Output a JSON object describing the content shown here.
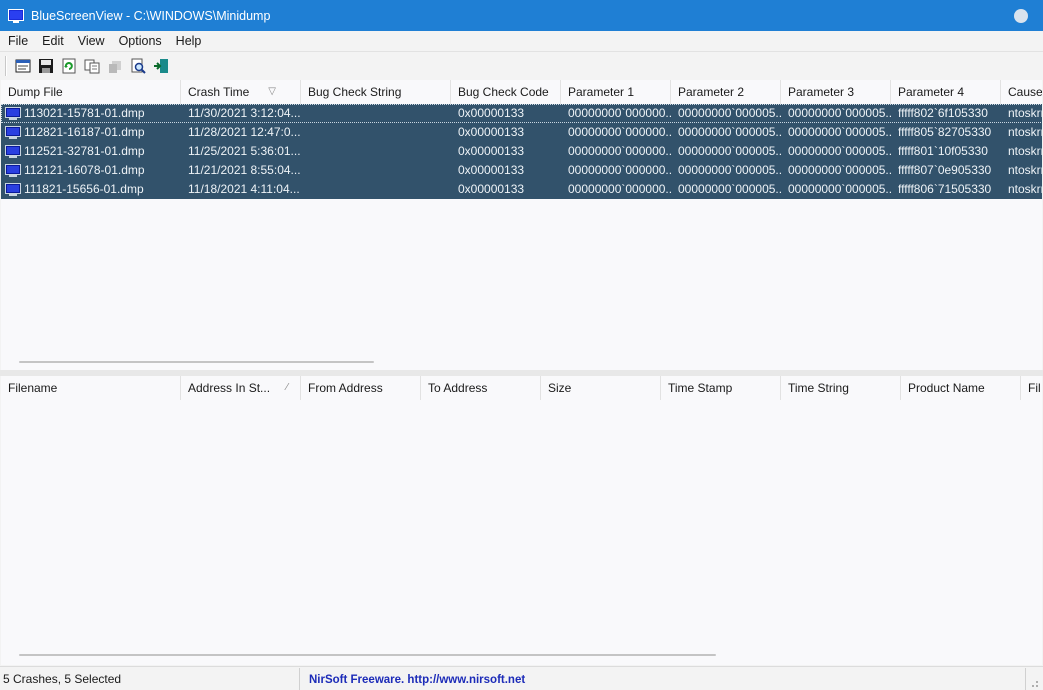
{
  "window": {
    "app_name": "BlueScreenView",
    "path": "C:\\WINDOWS\\Minidump",
    "title": "BlueScreenView  -  C:\\WINDOWS\\Minidump"
  },
  "menu": [
    "File",
    "Edit",
    "View",
    "Options",
    "Help"
  ],
  "toolbar": {
    "buttons": [
      "properties-icon",
      "save-icon",
      "refresh-icon",
      "copy-icon",
      "delete-icon",
      "find-icon",
      "exit-icon"
    ]
  },
  "crash_list": {
    "columns": [
      "Dump File",
      "Crash Time",
      "Bug Check String",
      "Bug Check Code",
      "Parameter 1",
      "Parameter 2",
      "Parameter 3",
      "Parameter 4",
      "Cause"
    ],
    "rows": [
      [
        "113021-15781-01.dmp",
        "11/30/2021 3:12:04...",
        "",
        "0x00000133",
        "00000000`000000...",
        "00000000`000005...",
        "00000000`000005...",
        "fffff802`6f105330",
        "ntoskrr"
      ],
      [
        "112821-16187-01.dmp",
        "11/28/2021 12:47:0...",
        "",
        "0x00000133",
        "00000000`000000...",
        "00000000`000005...",
        "00000000`000005...",
        "fffff805`82705330",
        "ntoskrr"
      ],
      [
        "112521-32781-01.dmp",
        "11/25/2021 5:36:01...",
        "",
        "0x00000133",
        "00000000`000000...",
        "00000000`000005...",
        "00000000`000005...",
        "fffff801`10f05330",
        "ntoskrr"
      ],
      [
        "112121-16078-01.dmp",
        "11/21/2021 8:55:04...",
        "",
        "0x00000133",
        "00000000`000000...",
        "00000000`000005...",
        "00000000`000005...",
        "fffff807`0e905330",
        "ntoskrr"
      ],
      [
        "111821-15656-01.dmp",
        "11/18/2021 4:11:04...",
        "",
        "0x00000133",
        "00000000`000000...",
        "00000000`000005...",
        "00000000`000005...",
        "fffff806`71505330",
        "ntoskrr"
      ]
    ]
  },
  "driver_list": {
    "columns": [
      "Filename",
      "Address In St...",
      "From Address",
      "To Address",
      "Size",
      "Time Stamp",
      "Time String",
      "Product Name",
      "Fil"
    ],
    "rows": []
  },
  "status": {
    "summary": "5 Crashes, 5 Selected",
    "link": "NirSoft Freeware.  http://www.nirsoft.net"
  },
  "colors": {
    "titlebar": "#1f7fd4",
    "selected_row": "#32526b",
    "link": "#1c2bb8"
  }
}
